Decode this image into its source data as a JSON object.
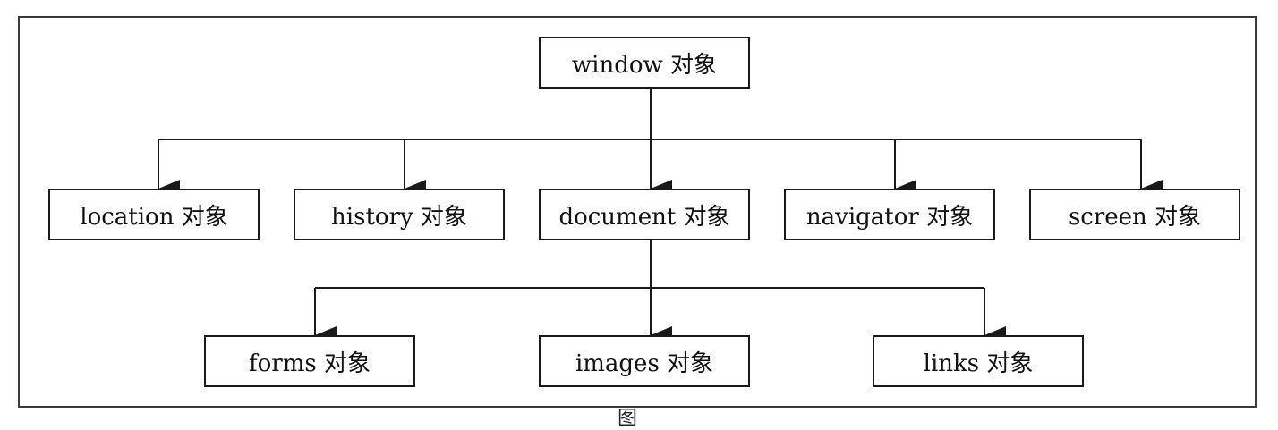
{
  "diagram": {
    "root": {
      "label": "window 对象"
    },
    "level1": [
      {
        "label": "location 对象"
      },
      {
        "label": "history 对象"
      },
      {
        "label": "document 对象"
      },
      {
        "label": "navigator 对象"
      },
      {
        "label": "screen 对象"
      }
    ],
    "level2": [
      {
        "label": "forms 对象"
      },
      {
        "label": "images 对象"
      },
      {
        "label": "links 对象"
      }
    ],
    "caption": "图"
  },
  "colors": {
    "line": "#1a1a1a",
    "frame": "#3a3a3a"
  }
}
